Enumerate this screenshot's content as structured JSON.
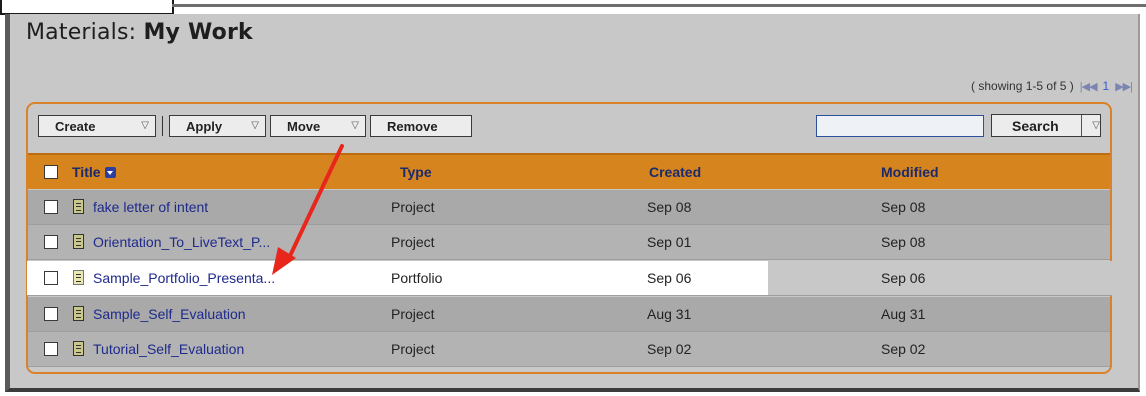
{
  "page": {
    "title_prefix": "Materials:",
    "title_main": "My Work"
  },
  "pager": {
    "showing": "( showing 1-5 of 5 )",
    "first_prev": "|◀◀",
    "current_page": "1",
    "next_last": "▶▶|"
  },
  "toolbar": {
    "create_label": "Create",
    "apply_label": "Apply",
    "move_label": "Move",
    "remove_label": "Remove",
    "search_value": "",
    "search_label": "Search"
  },
  "table": {
    "headers": {
      "title": "Title",
      "type": "Type",
      "created": "Created",
      "modified": "Modified"
    },
    "rows": [
      {
        "title": "fake letter of intent",
        "type": "Project",
        "created": "Sep 08",
        "modified": "Sep 08",
        "selected": false
      },
      {
        "title": "Orientation_To_LiveText_P...",
        "type": "Project",
        "created": "Sep 01",
        "modified": "Sep 08",
        "selected": false
      },
      {
        "title": "Sample_Portfolio_Presenta...",
        "type": "Portfolio",
        "created": "Sep 06",
        "modified": "Sep 06",
        "selected": true
      },
      {
        "title": "Sample_Self_Evaluation",
        "type": "Project",
        "created": "Aug 31",
        "modified": "Aug 31",
        "selected": false
      },
      {
        "title": "Tutorial_Self_Evaluation",
        "type": "Project",
        "created": "Sep 02",
        "modified": "Sep 02",
        "selected": false
      }
    ]
  },
  "colors": {
    "accent_orange": "#d6851e",
    "link_blue": "#1e2a8c",
    "annotation_arrow": "#e8261c"
  },
  "icons": [
    "sort-desc-icon",
    "document-icon",
    "dropdown-caret-icon",
    "red-annotation-arrow"
  ]
}
